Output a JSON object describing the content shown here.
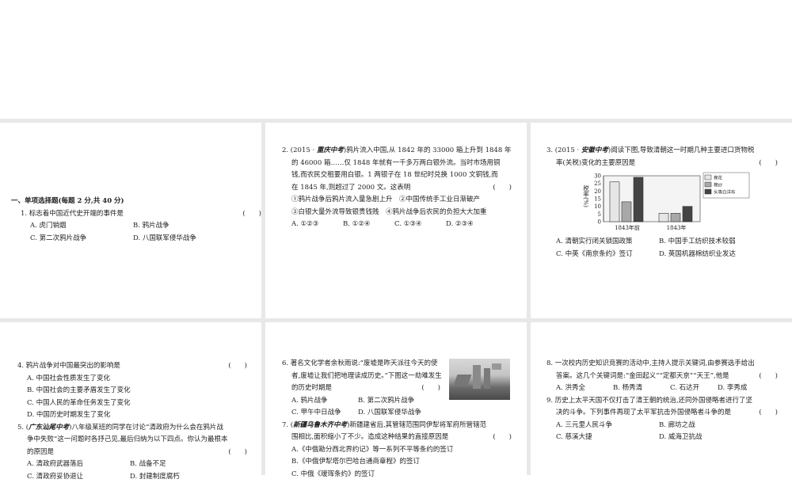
{
  "section": {
    "title": "一、单项选择题(每题 2 分,共 40 分)"
  },
  "paren": "(　　)",
  "q1": {
    "stem": "1. 标志着中国近代史开端的事件是",
    "options": [
      "A. 虎门销烟",
      "B. 鸦片战争",
      "C. 第二次鸦片战争",
      "D. 八国联军侵华战争"
    ]
  },
  "q2": {
    "prefix": "2. (2015 · ",
    "source": "重庆中考",
    "lines": [
      ")鸦片流入中国,从 1842 年的 33000 箱上升到 1848 年",
      "的 46000 箱……仅 1848 年就有一千多万两白银外流。当时市场用铜",
      "钱,而农民交租要用白银。1 两银子在 18 世纪时兑换 1000 文铜钱,而",
      "在 1845 年,则超过了 2000 文。这表明"
    ],
    "statements": [
      "①鸦片战争后鸦片流入量急剧上升　②中国传统手工业日渐破产",
      "③白银大量外流导致银贵钱贱　④鸦片战争后农民的负担大大加重"
    ],
    "options": [
      "A. ①②③",
      "B. ①②④",
      "C. ①③④",
      "D. ②③④"
    ]
  },
  "q3": {
    "prefix": "3. (2015 · ",
    "source": "安徽中考",
    "lines": [
      ")阅读下图,导致清朝这一时期几种主要进口货物税",
      "率(关税)变化的主要原因是"
    ],
    "options": [
      "A. 清朝实行闭关锁国政策",
      "B. 中国手工纺织技术较弱",
      "C. 中英《南京条约》签订",
      "D. 英国机器棉纺织业发达"
    ]
  },
  "chart_data": {
    "type": "bar",
    "categories": [
      "1843年前",
      "1843年"
    ],
    "series": [
      {
        "name": "棉花",
        "values": [
          26,
          5.5
        ],
        "color": "#e6e6e6"
      },
      {
        "name": "棉纱",
        "values": [
          13,
          5.5
        ],
        "color": "#a8a8a8"
      },
      {
        "name": "头等白洋布",
        "values": [
          29,
          10
        ],
        "color": "#444444"
      }
    ],
    "ylabel": "税率(%)",
    "ylim": [
      0,
      30
    ],
    "yticks": [
      "0",
      "5",
      "10",
      "15",
      "20",
      "25",
      "30"
    ],
    "legend": "top-right"
  },
  "q4": {
    "stem": "4. 鸦片战争对中国最突出的影响是",
    "options": [
      "A. 中国社会性质发生了变化",
      "B. 中国社会的主要矛盾发生了变化",
      "C. 中国人民的革命任务发生了变化",
      "D. 中国历史时期发生了变化"
    ]
  },
  "q5": {
    "prefix": "5. (",
    "source": "广东汕尾中考",
    "lines": [
      ")八年级某班的同学在讨论“清政府为什么会在鸦片战",
      "争中失败”这一问题时各抒己见,最后归纳为以下四点。你认为最根本",
      "的原因是"
    ],
    "options": [
      "A. 清政府武器落后",
      "B. 战备不足",
      "C. 清政府妥协退让",
      "D. 封建制度腐朽"
    ]
  },
  "q6": {
    "lines": [
      "6. 著名文化学者余秋雨说:“废墟是昨天派往今天的使",
      "者,废墟让我们把地理读成历史。”下图这一劫难发生",
      "的历史时期是"
    ],
    "options": [
      "A. 鸦片战争",
      "B. 第二次鸦片战争",
      "C. 甲午中日战争",
      "D. 八国联军侵华战争"
    ]
  },
  "q7": {
    "prefix": "7. (",
    "source": "新疆乌鲁木齐中考",
    "lines": [
      ")新疆建省后,其管辖范围同伊犁将军府所管辖范",
      "围相比,面积缩小了不少。造成这种结果的直接原因是"
    ],
    "options": [
      "A.《中俄勘分西北界约记》等一系列不平等条约的签订",
      "B.《中俄伊犁塔尔巴哈台通商章程》的签订",
      "C. 中俄《瑷珲条约》的签订"
    ]
  },
  "q8": {
    "lines": [
      "8. 一次校内历史知识竞赛的活动中,主持人提示关键词,由参赛选手给出",
      "答案。这几个关键词是:“金田起义”“定都天京”“天王”,他是"
    ],
    "options": [
      "A. 洪秀全",
      "B. 杨秀清",
      "C. 石达开",
      "D. 李秀成"
    ]
  },
  "q9": {
    "lines": [
      "9. 历史上太平天国不仅打击了清王朝的统治,还同外国侵略者进行了坚",
      "决的斗争。下列事件再现了太平军抗击外国侵略者斗争的是"
    ],
    "options": [
      "A. 三元里人民斗争",
      "B. 廊坊之战",
      "C. 慈溪大捷",
      "D. 威海卫抗战"
    ]
  }
}
